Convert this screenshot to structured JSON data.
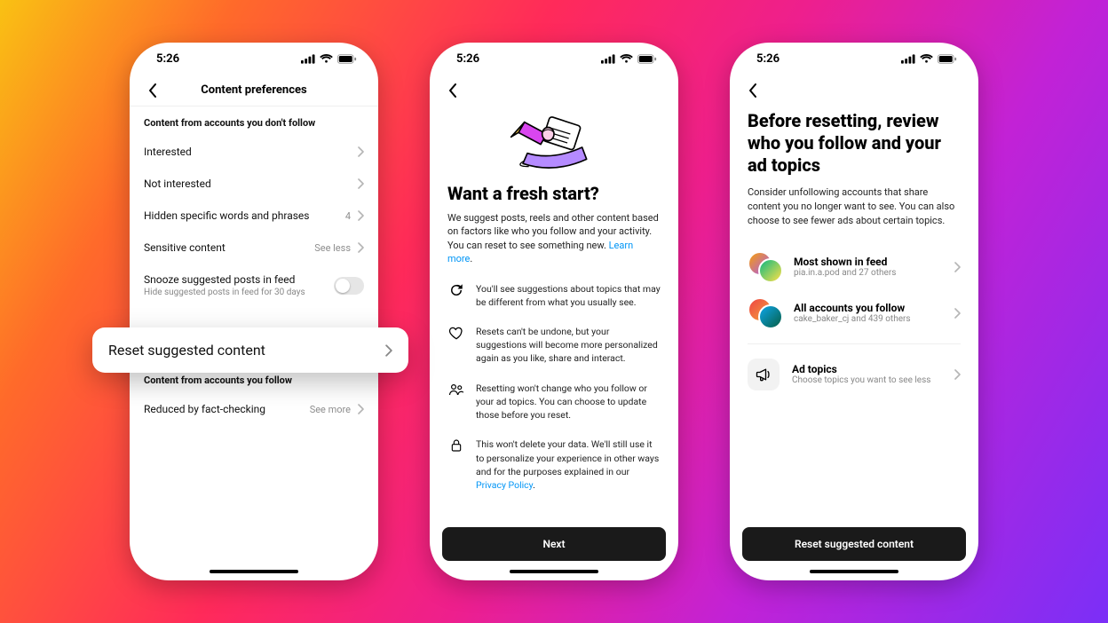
{
  "status_time": "5:26",
  "phone1": {
    "title": "Content preferences",
    "section1": "Content from accounts you don't follow",
    "rows": {
      "interested": "Interested",
      "not_interested": "Not interested",
      "hidden_words": "Hidden specific words and phrases",
      "hidden_words_count": "4",
      "sensitive": "Sensitive content",
      "sensitive_right": "See less",
      "snooze_label": "Snooze suggested posts in feed",
      "snooze_desc": "Hide suggested posts in feed for 30 days"
    },
    "popout_label": "Reset suggested content",
    "section2": "Content from accounts you follow",
    "reduced": "Reduced by fact-checking",
    "reduced_right": "See more"
  },
  "phone2": {
    "title": "Want a fresh start?",
    "desc": "We suggest posts, reels and other content based on factors like who you follow and your activity. You can reset to see something new.",
    "learn_more": "Learn more",
    "bullets": {
      "b1": "You'll see suggestions about topics that may be different from what you usually see.",
      "b2": "Resets can't be undone, but your suggestions will become more personalized again as you like, share and interact.",
      "b3": "Resetting won't change who you follow or your ad topics. You can choose to update those before you reset.",
      "b4a": "This won't delete your data. We'll still use it to personalize your experience in other ways and for the purposes explained in our ",
      "b4_link": "Privacy Policy"
    },
    "next_btn": "Next"
  },
  "phone3": {
    "title": "Before resetting, review who you follow and your ad topics",
    "desc": "Consider unfollowing accounts that share content you no longer want to see. You can also choose to see fewer ads about certain topics.",
    "most_shown_title": "Most shown in feed",
    "most_shown_sub": "pia.in.a.pod and 27 others",
    "all_follow_title": "All accounts you follow",
    "all_follow_sub": "cake_baker_cj and 439 others",
    "ad_topics_title": "Ad topics",
    "ad_topics_sub": "Choose topics you want to see less",
    "reset_btn": "Reset suggested content"
  }
}
